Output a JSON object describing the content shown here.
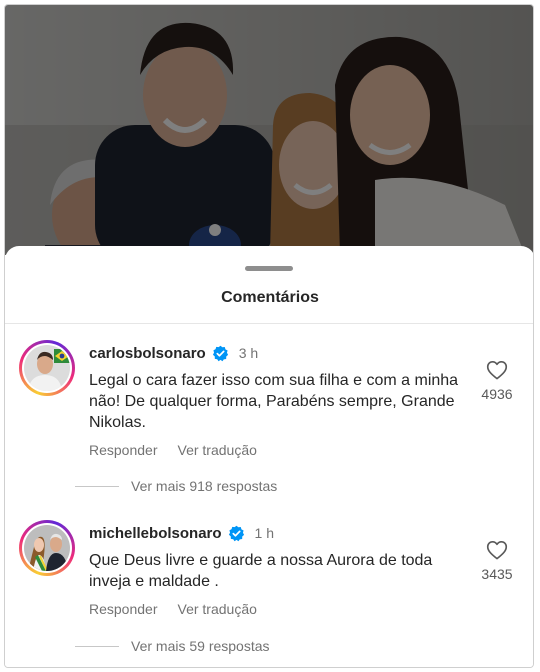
{
  "sheet": {
    "title": "Comentários"
  },
  "comments": [
    {
      "username": "carlosbolsonaro",
      "time": "3 h",
      "text": "Legal o cara fazer isso com sua filha e com a minha não! De qualquer forma, Parabéns sempre, Grande Nikolas.",
      "reply_label": "Responder",
      "translate_label": "Ver tradução",
      "likes": "4936",
      "view_replies": "Ver mais 918 respostas"
    },
    {
      "username": "michellebolsonaro",
      "time": "1 h",
      "text": "Que Deus livre e guarde a  nossa Aurora de toda inveja e maldade .",
      "reply_label": "Responder",
      "translate_label": "Ver tradução",
      "likes": "3435",
      "view_replies": "Ver mais 59 respostas"
    }
  ],
  "icons": {
    "verified": "verified-badge-icon",
    "like": "heart-outline-icon",
    "handle": "drag-handle"
  },
  "colors": {
    "verified_blue": "#0095f6",
    "text_primary": "#262626",
    "text_secondary": "#737373"
  }
}
